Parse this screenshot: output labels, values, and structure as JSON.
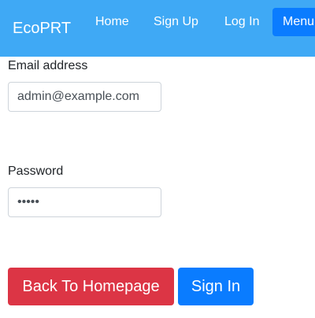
{
  "navbar": {
    "brand": "EcoPRT",
    "links": [
      {
        "label": "Home"
      },
      {
        "label": "Sign Up"
      },
      {
        "label": "Log In"
      }
    ],
    "menu_label": "Menu",
    "background_color": "#3fa9f5",
    "menu_color": "#0a7cff"
  },
  "form": {
    "email": {
      "label": "Email address",
      "value": "admin@example.com"
    },
    "password": {
      "label": "Password",
      "value": "•••••"
    }
  },
  "buttons": {
    "back_label": "Back To Homepage",
    "back_color": "#dc3545",
    "signin_label": "Sign In",
    "signin_color": "#0a7cff"
  }
}
